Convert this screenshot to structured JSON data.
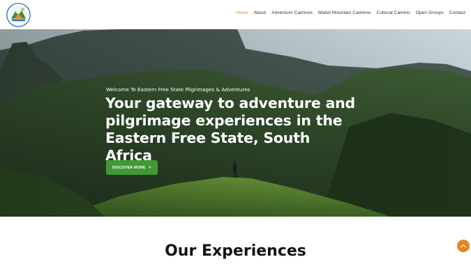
{
  "nav": {
    "items": [
      {
        "label": "Home",
        "active": true
      },
      {
        "label": "About",
        "active": false
      },
      {
        "label": "Adventure Caminos",
        "active": false
      },
      {
        "label": "Maluti Mountain Caminos",
        "active": false
      },
      {
        "label": "Cultural Camino",
        "active": false
      },
      {
        "label": "Open Groups",
        "active": false
      },
      {
        "label": "Contact",
        "active": false
      }
    ]
  },
  "hero": {
    "welcome": "Welcome To Eastern Free State Pilgrimages & Adventures",
    "headline": "Your gateway to adventure and pilgrimage experiences in the Eastern Free State, South Africa",
    "cta_label": "DISCOVER MORE",
    "cta_icon": "double-chevron-right-icon"
  },
  "section": {
    "title": "Our Experiences"
  },
  "colors": {
    "accent": "#e68a2e",
    "cta": "#3f9a35",
    "scroll_top": "#e8851f"
  }
}
